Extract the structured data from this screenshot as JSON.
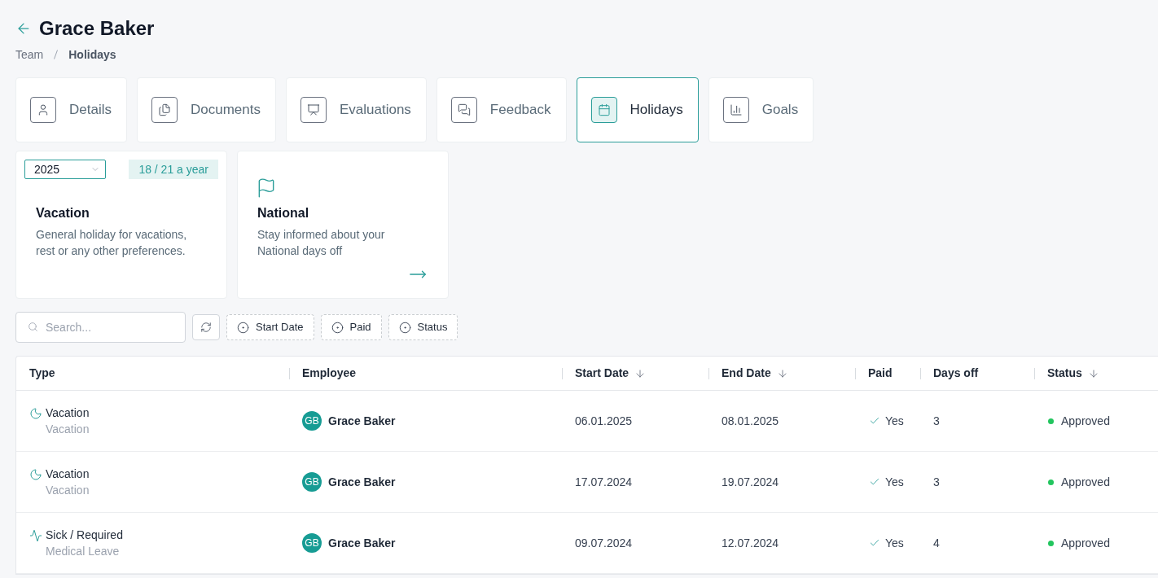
{
  "header": {
    "title": "Grace Baker",
    "breadcrumb": [
      {
        "label": "Team",
        "current": false
      },
      {
        "label": "Holidays",
        "current": true
      }
    ]
  },
  "tabs": [
    {
      "kind": "details",
      "label": "Details",
      "selected": false
    },
    {
      "kind": "documents",
      "label": "Documents",
      "selected": false
    },
    {
      "kind": "evaluations",
      "label": "Evaluations",
      "selected": false
    },
    {
      "kind": "feedback",
      "label": "Feedback",
      "selected": false
    },
    {
      "kind": "holidays",
      "label": "Holidays",
      "selected": true
    },
    {
      "kind": "goals",
      "label": "Goals",
      "selected": false
    }
  ],
  "holiday_types": [
    {
      "kind": "vacation",
      "year": "2025",
      "allowance": "18 / 21 a year",
      "title": "Vacation",
      "description": "General holiday for vacations, rest or any other preferences."
    },
    {
      "kind": "national",
      "title": "National",
      "description": "Stay informed about your National days off"
    }
  ],
  "toolbar": {
    "search": {
      "placeholder": "Search..."
    },
    "filters": [
      "Start Date",
      "Paid",
      "Status"
    ]
  },
  "table": {
    "columns": [
      {
        "label": "Type",
        "sorted": false
      },
      {
        "label": "Employee",
        "sorted": false
      },
      {
        "label": "Start Date",
        "sorted": true
      },
      {
        "label": "End Date",
        "sorted": true
      },
      {
        "label": "Paid",
        "sorted": false
      },
      {
        "label": "Days off",
        "sorted": false
      },
      {
        "label": "Status",
        "sorted": true
      }
    ],
    "rows": [
      {
        "type": {
          "kind": "vacation",
          "label": "Vacation",
          "sublabel": "Vacation"
        },
        "employee": {
          "initials": "GB",
          "name": "Grace Baker"
        },
        "start_date": "06.01.2025",
        "end_date": "08.01.2025",
        "paid": {
          "label": "Yes",
          "checked": true
        },
        "days_off": "3",
        "status": {
          "label": "Approved",
          "color": "#22c55e"
        }
      },
      {
        "type": {
          "kind": "vacation",
          "label": "Vacation",
          "sublabel": "Vacation"
        },
        "employee": {
          "initials": "GB",
          "name": "Grace Baker"
        },
        "start_date": "17.07.2024",
        "end_date": "19.07.2024",
        "paid": {
          "label": "Yes",
          "checked": true
        },
        "days_off": "3",
        "status": {
          "label": "Approved",
          "color": "#22c55e"
        }
      },
      {
        "type": {
          "kind": "sick",
          "label": "Sick / Required",
          "sublabel": "Medical Leave"
        },
        "employee": {
          "initials": "GB",
          "name": "Grace Baker"
        },
        "start_date": "09.07.2024",
        "end_date": "12.07.2024",
        "paid": {
          "label": "Yes",
          "checked": true
        },
        "days_off": "4",
        "status": {
          "label": "Approved",
          "color": "#22c55e"
        }
      }
    ]
  }
}
